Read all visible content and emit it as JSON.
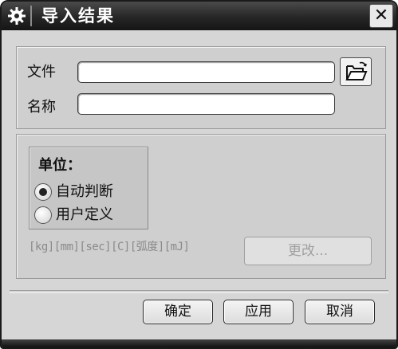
{
  "window": {
    "title": "导入结果",
    "title_icon": "gear-icon",
    "close_label": "✕"
  },
  "file_section": {
    "file_label": "文件",
    "file_value": "",
    "name_label": "名称",
    "name_value": "",
    "browse_icon": "folder-open-icon"
  },
  "units": {
    "group_title": "单位：",
    "options": [
      {
        "label": "自动判断",
        "selected": true
      },
      {
        "label": "用户定义",
        "selected": false
      }
    ],
    "unit_list": "[kg][mm][sec][C][弧度][mJ]",
    "change_label": "更改..."
  },
  "buttons": {
    "ok": "确定",
    "apply": "应用",
    "cancel": "取消"
  },
  "colors": {
    "titlebar": "#262626",
    "dialog_bg": "#d6d6d6",
    "disabled_text": "#a0a0a0"
  }
}
